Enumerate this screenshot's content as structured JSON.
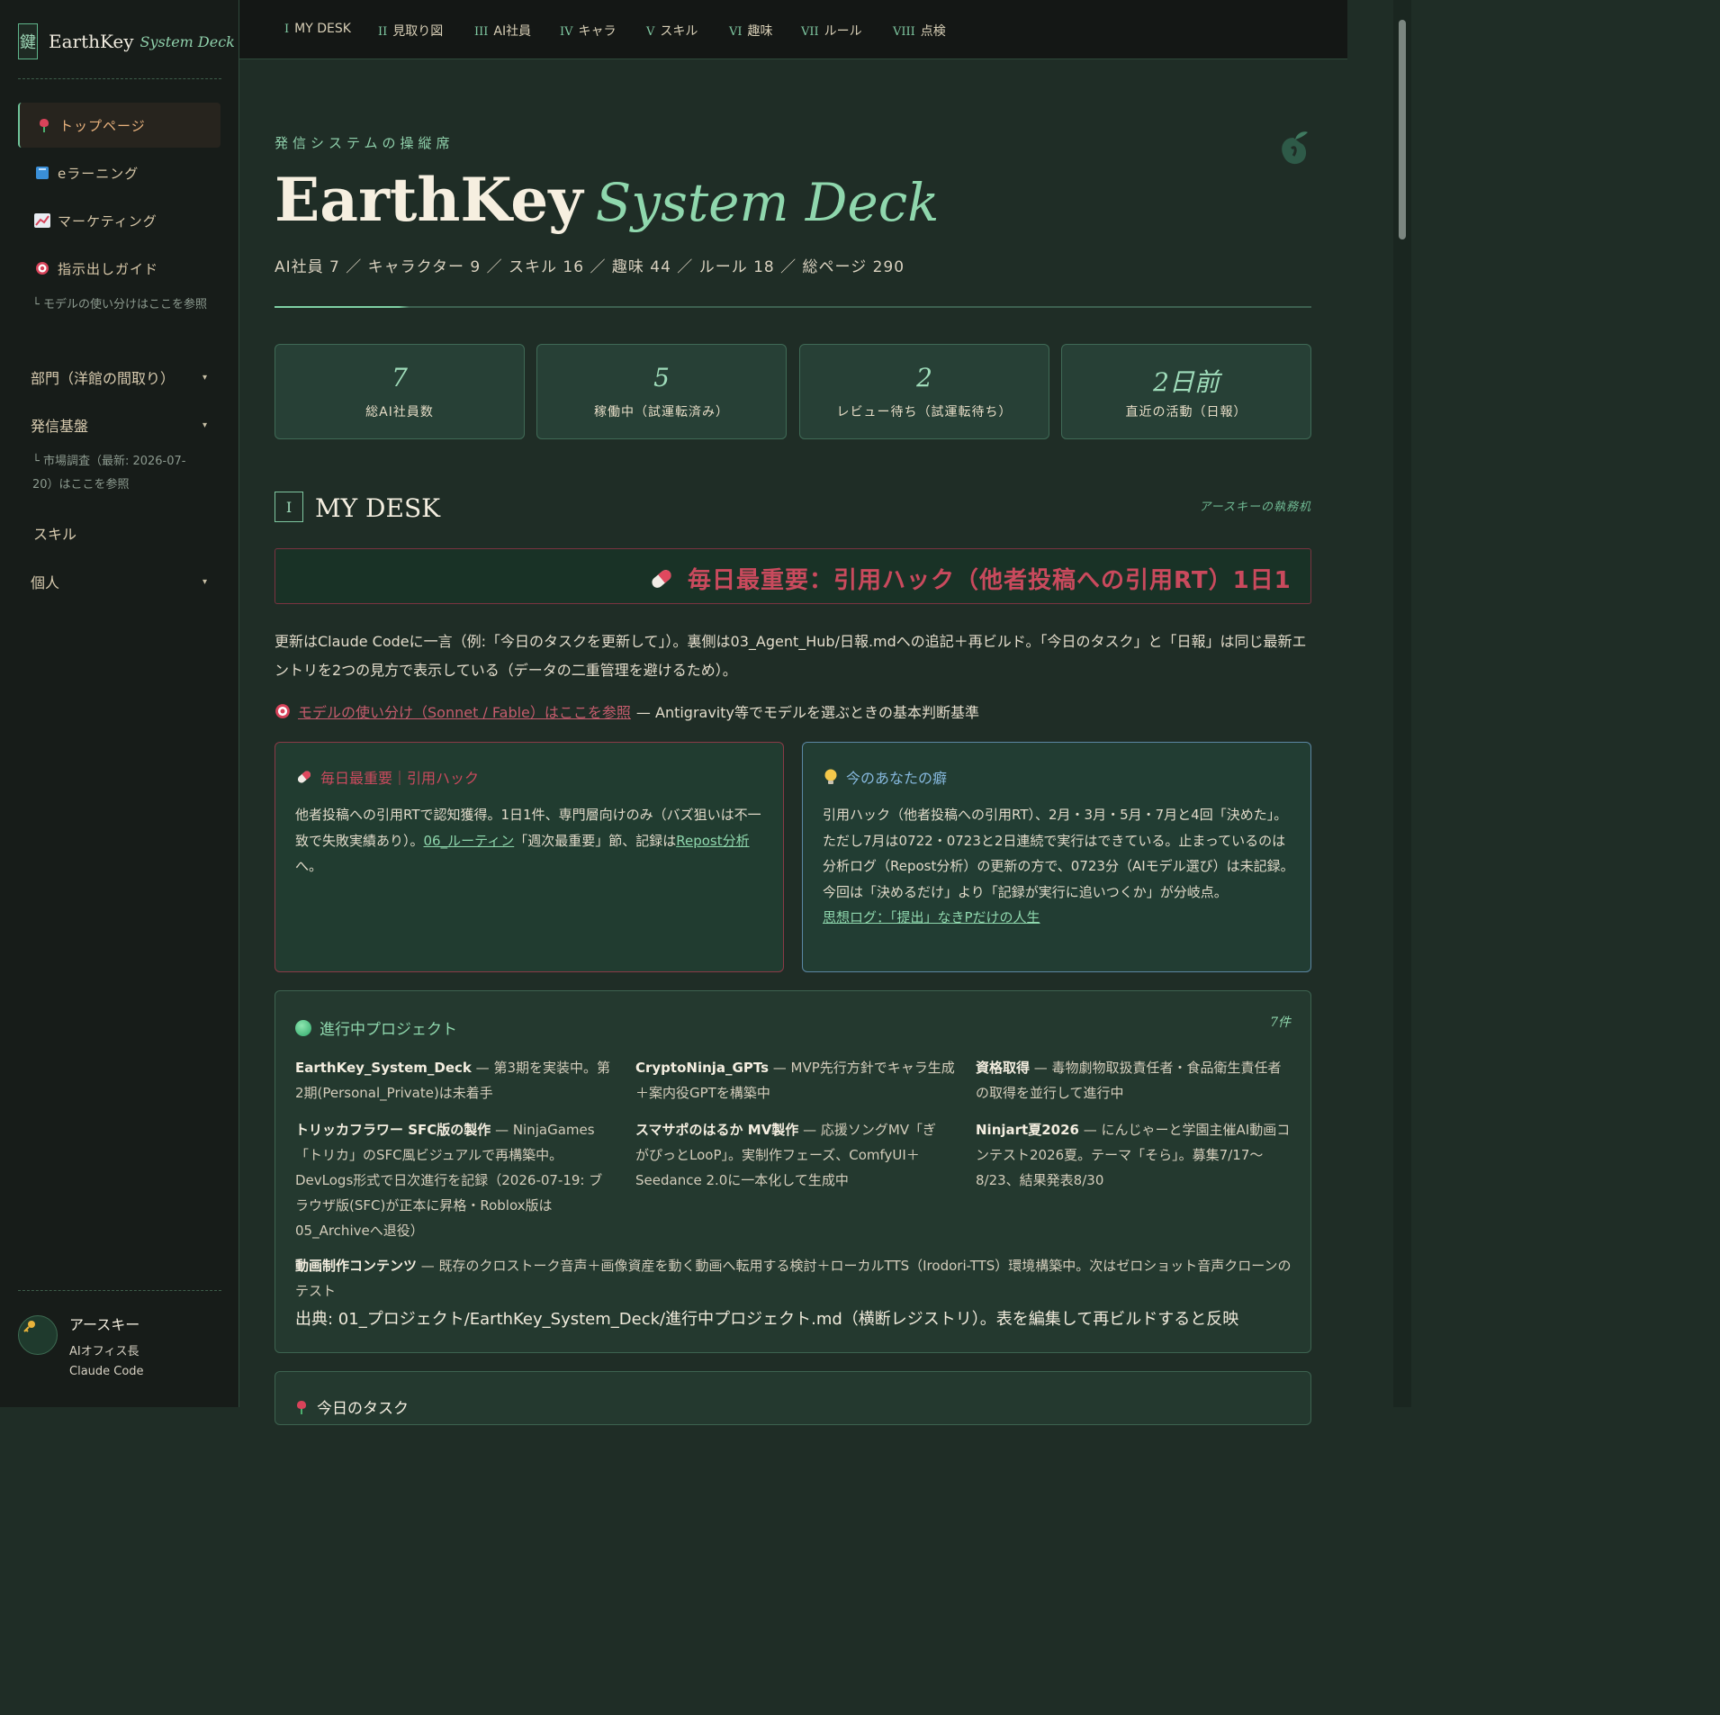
{
  "sidebar": {
    "brand_mark": "鍵",
    "brand_name": "EarthKey",
    "brand_sub": "System Deck",
    "items": [
      {
        "label": "トップページ",
        "icon": "rose-icon"
      },
      {
        "label": "eラーニング",
        "icon": "book-icon"
      },
      {
        "label": "マーケティング",
        "icon": "chart-icon"
      },
      {
        "label": "指示出しガイド",
        "icon": "target-icon"
      }
    ],
    "guide_sub": "└ モデルの使い分けはここを参照",
    "groups": [
      {
        "label": "部門（洋館の間取り）",
        "caret": "▾"
      },
      {
        "label": "発信基盤",
        "caret": "▾"
      }
    ],
    "market_sub": "└ 市場調査（最新: 2026-07-20）はここを参照",
    "skill_label": "スキル",
    "personal_group": {
      "label": "個人",
      "caret": "▾"
    },
    "user": {
      "name": "アースキー",
      "role": "AIオフィス長",
      "tool": "Claude Code"
    }
  },
  "topnav": [
    {
      "num": "I",
      "label": "MY DESK"
    },
    {
      "num": "II",
      "label": "見取り図"
    },
    {
      "num": "III",
      "label": "AI社員"
    },
    {
      "num": "IV",
      "label": "キャラ"
    },
    {
      "num": "V",
      "label": "スキル"
    },
    {
      "num": "VI",
      "label": "趣味"
    },
    {
      "num": "VII",
      "label": "ルール"
    },
    {
      "num": "VIII",
      "label": "点検"
    }
  ],
  "hero": {
    "eyebrow": "発信システムの操縦席",
    "title_main": "EarthKey",
    "title_sub": "System Deck",
    "stats": "AI社員 7 ／ キャラクター 9 ／ スキル 16 ／ 趣味 44 ／ ルール 18 ／ 総ページ 290"
  },
  "cards": [
    {
      "value": "7",
      "label": "総AI社員数"
    },
    {
      "value": "5",
      "label": "稼働中（試運転済み）"
    },
    {
      "value": "2",
      "label": "レビュー待ち（試運転待ち）"
    },
    {
      "value": "2日前",
      "label": "直近の活動（日報）"
    }
  ],
  "section": {
    "num": "I",
    "title": "MY DESK",
    "tag": "アースキーの執務机"
  },
  "marquee": "毎日最重要：引用ハック（他者投稿への引用RT）1日1",
  "description": "更新はClaude Codeに一言（例:「今日のタスクを更新して」）。裏側は03_Agent_Hub/日報.mdへの追記＋再ビルド。「今日のタスク」と「日報」は同じ最新エントリを2つの見方で表示している（データの二重管理を避けるため）。",
  "model_link": {
    "text": "モデルの使い分け（Sonnet / Fable）はここを参照",
    "suffix": "— Antigravity等でモデルを選ぶときの基本判断基準"
  },
  "box_hack": {
    "title": "毎日最重要｜引用ハック",
    "text1": "他者投稿への引用RTで認知獲得。1日1件、専門層向けのみ（バズ狙いは不一致で失敗実績あり）。",
    "link1": "06_ルーティン",
    "text2": "「週次最重要」節、記録は",
    "link2": "Repost分析",
    "text3": "へ。"
  },
  "box_habit": {
    "title": "今のあなたの癖",
    "text": "引用ハック（他者投稿への引用RT）、2月・3月・5月・7月と4回「決めた」。ただし7月は0722・0723と2日連続で実行はできている。止まっているのは分析ログ（Repost分析）の更新の方で、0723分（AIモデル選び）は未記録。今回は「決めるだけ」より「記録が実行に追いつくか」が分岐点。",
    "link": "思想ログ：「提出」なきPだけの人生"
  },
  "projects": {
    "title": "進行中プロジェクト",
    "count": "7件",
    "items": [
      {
        "name": "EarthKey_System_Deck",
        "desc": " — 第3期を実装中。第2期(Personal_Private)は未着手"
      },
      {
        "name": "CryptoNinja_GPTs",
        "desc": " — MVP先行方針でキャラ生成＋案内役GPTを構築中"
      },
      {
        "name": "資格取得",
        "desc": " — 毒物劇物取扱責任者・食品衛生責任者の取得を並行して進行中"
      },
      {
        "name": "トリッカフラワー SFC版の製作",
        "desc": " — NinjaGames「トリカ」のSFC風ビジュアルで再構築中。DevLogs形式で日次進行を記録（2026-07-19: ブラウザ版(SFC)が正本に昇格・Roblox版は05_Archiveへ退役）"
      },
      {
        "name": "スマサポのはるか MV製作",
        "desc": " — 応援ソングMV「ぎがぴっとLooP」。実制作フェーズ、ComfyUI＋Seedance 2.0に一本化して生成中"
      },
      {
        "name": "Ninjart夏2026",
        "desc": " — にんじゃーと学園主催AI動画コンテスト2026夏。テーマ「そら」。募集7/17〜8/23、結果発表8/30"
      },
      {
        "name": "動画制作コンテンツ",
        "desc": " — 既存のクロストーク音声＋画像資産を動く動画へ転用する検討＋ローカルTTS（Irodori-TTS）環境構築中。次はゼロショット音声クローンのテスト"
      }
    ],
    "source": "出典: 01_プロジェクト/EarthKey_System_Deck/進行中プロジェクト.md（横断レジストリ）。表を編集して再ビルドすると反映"
  },
  "next_section": {
    "title": "今日のタスク"
  }
}
